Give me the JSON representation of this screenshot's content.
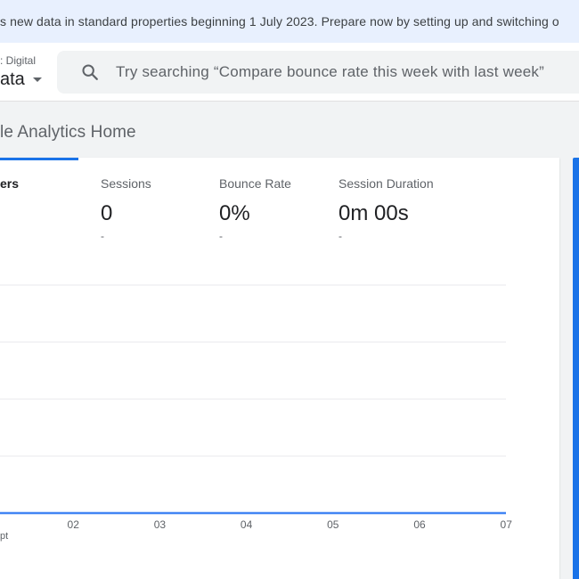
{
  "banner": {
    "text": "s new data in standard properties beginning 1 July 2023. Prepare now by setting up and switching o"
  },
  "account": {
    "sub_label": ": Digital",
    "name": "ata"
  },
  "search": {
    "placeholder": "Try searching “Compare bounce rate this week with last week”"
  },
  "page": {
    "title": "le Analytics Home"
  },
  "metrics": [
    {
      "label": "ers",
      "value": "",
      "delta": "",
      "active": true
    },
    {
      "label": "Sessions",
      "value": "0",
      "delta": "-"
    },
    {
      "label": "Bounce Rate",
      "value": "0%",
      "delta": "-"
    },
    {
      "label": "Session Duration",
      "value": "0m 00s",
      "delta": "-"
    }
  ],
  "colors": {
    "accent": "#1a73e8",
    "banner_bg": "#e8f0fe",
    "gridline": "#e8eaed",
    "line": "#4285f4"
  },
  "chart_data": {
    "type": "line",
    "x": [
      "",
      "02",
      "03",
      "04",
      "05",
      "06",
      "07"
    ],
    "x_sublabel": "pt",
    "series": [
      {
        "values": [
          0,
          0,
          0,
          0,
          0,
          0,
          0
        ]
      }
    ],
    "gridlines": 5,
    "grid": true
  }
}
